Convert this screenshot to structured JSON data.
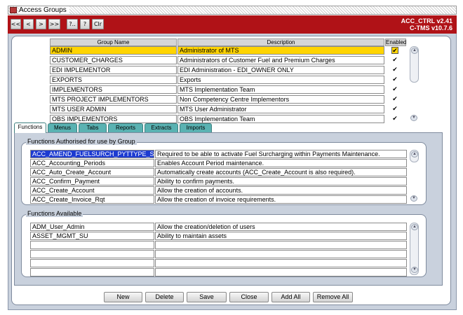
{
  "window": {
    "title": "Access Groups"
  },
  "header": {
    "buttons": [
      "<<",
      "<",
      ">",
      ">>",
      "?..",
      "?",
      "Clr"
    ],
    "version_line1": "ACC_CTRL v2.41",
    "version_line2": "C-TMS v10.7.6"
  },
  "groups": {
    "columns": {
      "name": "Group Name",
      "description": "Description",
      "enabled": "Enabled"
    },
    "rows": [
      {
        "name": "ADMIN",
        "description": "Administrator of MTS",
        "enabled": "✔"
      },
      {
        "name": "CUSTOMER_CHARGES",
        "description": "Administrators of Customer Fuel and Premium Charges",
        "enabled": "✔"
      },
      {
        "name": "EDI IMPLEMENTOR",
        "description": "EDI Administration - EDI_OWNER ONLY",
        "enabled": "✔"
      },
      {
        "name": "EXPORTS",
        "description": "Exports",
        "enabled": "✔"
      },
      {
        "name": "IMPLEMENTORS",
        "description": "MTS Implementation Team",
        "enabled": "✔"
      },
      {
        "name": "MTS PROJECT IMPLEMENTORS",
        "description": "Non Competency Centre Implementors",
        "enabled": "✔"
      },
      {
        "name": "MTS USER ADMIN",
        "description": "MTS User Administrator",
        "enabled": "✔"
      },
      {
        "name": "OBS IMPLEMENTORS",
        "description": "OBS Implementation Team",
        "enabled": "✔"
      }
    ]
  },
  "tabs": [
    "Functions",
    "Menus",
    "Tabs",
    "Reports",
    "Extracts",
    "Imports"
  ],
  "functions_authorised": {
    "legend": "Functions Authorised for use by Group",
    "rows": [
      {
        "name": "ACC_AMEND_FUELSURCH_PYTTYPE_S",
        "description": "Required to be able to activate Fuel Surcharging within Payments Maintenance."
      },
      {
        "name": "ACC_Accounting_Periods",
        "description": "Enables Account Period maintenance."
      },
      {
        "name": "ACC_Auto_Create_Account",
        "description": "Automatically create accounts (ACC_Create_Account is also required)."
      },
      {
        "name": "ACC_Confirm_Payment",
        "description": "Ability to confirm payments."
      },
      {
        "name": "ACC_Create_Account",
        "description": "Allow the creation of accounts."
      },
      {
        "name": "ACC_Create_Invoice_Rqt",
        "description": "Allow the creation of invoice requirements."
      }
    ]
  },
  "functions_available": {
    "legend": "Functions Available",
    "rows": [
      {
        "name": "ADM_User_Admin",
        "description": "Allow the creation/deletion of users"
      },
      {
        "name": "ASSET_MGMT_SU",
        "description": "Ability to maintain assets"
      },
      {
        "name": "",
        "description": ""
      },
      {
        "name": "",
        "description": ""
      },
      {
        "name": "",
        "description": ""
      },
      {
        "name": "",
        "description": ""
      }
    ]
  },
  "actions": [
    "New",
    "Delete",
    "Save",
    "Close",
    "Add All",
    "Remove All"
  ],
  "colors": {
    "header_red": "#b01217",
    "selection_yellow": "#ffd400",
    "focus_blue": "#1d3bd1",
    "tab_teal": "#5ab2b2"
  }
}
